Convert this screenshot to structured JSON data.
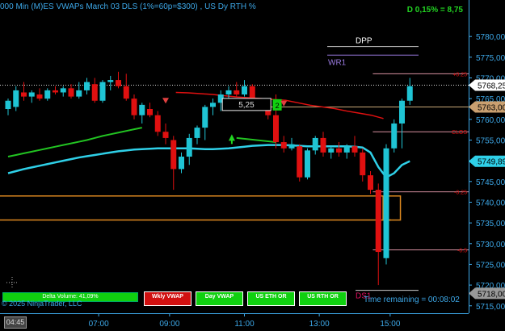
{
  "header": {
    "title": "000 Min (M)ES VWAPs March 03 DLS (1%=60p=$300) , US Dy RTH %",
    "daily_change": "D 0,15% = 8,75"
  },
  "colors": {
    "up": "#1fc4d4",
    "down": "#e01010",
    "vwap": "#2fd0e8",
    "green_line": "#22c422",
    "red_line": "#e01010",
    "orange_line": "#e08a20",
    "pink_line": "#d890a0",
    "axis": "#3da8e8"
  },
  "chart_data": {
    "type": "candlestick",
    "x_ticks": [
      "07:00",
      "09:00",
      "11:00",
      "13:00",
      "15:00"
    ],
    "y_ticks": [
      5715,
      5720,
      5725,
      5730,
      5735,
      5740,
      5745,
      5750,
      5755,
      5760,
      5765,
      5770,
      5775,
      5780
    ],
    "ylim": [
      5713.2,
      5785.3
    ],
    "price_labels": [
      {
        "value": 5768.25,
        "label": "5768,25",
        "style": "white"
      },
      {
        "value": 5763.0,
        "label": "5763,00",
        "style": "tan"
      },
      {
        "value": 5749.89,
        "label": "5749,89",
        "style": "cyan"
      },
      {
        "value": 5718.0,
        "label": "5718,00",
        "style": "grey"
      }
    ],
    "candles": [
      {
        "o": 5762.5,
        "h": 5765.0,
        "l": 5761.0,
        "c": 5764.5
      },
      {
        "o": 5763.0,
        "h": 5768.0,
        "l": 5762.0,
        "c": 5767.0
      },
      {
        "o": 5766.5,
        "h": 5769.0,
        "l": 5764.5,
        "c": 5765.5
      },
      {
        "o": 5765.5,
        "h": 5767.0,
        "l": 5764.0,
        "c": 5766.5
      },
      {
        "o": 5766.0,
        "h": 5767.5,
        "l": 5764.5,
        "c": 5765.0
      },
      {
        "o": 5765.0,
        "h": 5767.5,
        "l": 5764.5,
        "c": 5767.0
      },
      {
        "o": 5767.0,
        "h": 5768.0,
        "l": 5766.0,
        "c": 5766.5
      },
      {
        "o": 5766.5,
        "h": 5768.0,
        "l": 5765.5,
        "c": 5767.5
      },
      {
        "o": 5767.5,
        "h": 5768.5,
        "l": 5765.0,
        "c": 5765.5
      },
      {
        "o": 5765.5,
        "h": 5769.0,
        "l": 5765.0,
        "c": 5767.0
      },
      {
        "o": 5767.0,
        "h": 5770.0,
        "l": 5766.0,
        "c": 5769.0
      },
      {
        "o": 5768.5,
        "h": 5770.0,
        "l": 5764.0,
        "c": 5764.5
      },
      {
        "o": 5764.5,
        "h": 5769.5,
        "l": 5764.0,
        "c": 5769.0
      },
      {
        "o": 5769.0,
        "h": 5770.5,
        "l": 5767.0,
        "c": 5769.5
      },
      {
        "o": 5769.5,
        "h": 5771.5,
        "l": 5767.5,
        "c": 5768.0
      },
      {
        "o": 5768.0,
        "h": 5771.0,
        "l": 5764.5,
        "c": 5765.0
      },
      {
        "o": 5765.0,
        "h": 5766.0,
        "l": 5760.0,
        "c": 5761.0
      },
      {
        "o": 5761.0,
        "h": 5764.0,
        "l": 5759.0,
        "c": 5763.5
      },
      {
        "o": 5762.5,
        "h": 5764.0,
        "l": 5760.5,
        "c": 5761.0
      },
      {
        "o": 5761.0,
        "h": 5762.0,
        "l": 5756.0,
        "c": 5757.0
      },
      {
        "o": 5757.0,
        "h": 5759.0,
        "l": 5754.0,
        "c": 5755.5
      },
      {
        "o": 5755.0,
        "h": 5756.0,
        "l": 5743.0,
        "c": 5748.0
      },
      {
        "o": 5748.0,
        "h": 5752.0,
        "l": 5747.0,
        "c": 5751.0
      },
      {
        "o": 5751.0,
        "h": 5756.5,
        "l": 5749.0,
        "c": 5755.5
      },
      {
        "o": 5755.5,
        "h": 5758.5,
        "l": 5754.0,
        "c": 5758.0
      },
      {
        "o": 5758.0,
        "h": 5763.5,
        "l": 5755.0,
        "c": 5763.0
      },
      {
        "o": 5763.0,
        "h": 5765.0,
        "l": 5761.0,
        "c": 5764.0
      },
      {
        "o": 5764.0,
        "h": 5767.0,
        "l": 5762.0,
        "c": 5766.0
      },
      {
        "o": 5766.0,
        "h": 5768.0,
        "l": 5764.0,
        "c": 5767.0
      },
      {
        "o": 5767.0,
        "h": 5769.0,
        "l": 5765.5,
        "c": 5766.0
      },
      {
        "o": 5766.0,
        "h": 5769.5,
        "l": 5765.5,
        "c": 5768.0
      },
      {
        "o": 5768.0,
        "h": 5768.5,
        "l": 5763.0,
        "c": 5764.0
      },
      {
        "o": 5764.0,
        "h": 5765.0,
        "l": 5762.5,
        "c": 5763.0
      },
      {
        "o": 5763.0,
        "h": 5764.5,
        "l": 5760.0,
        "c": 5761.0
      },
      {
        "o": 5761.0,
        "h": 5766.0,
        "l": 5753.0,
        "c": 5754.5
      },
      {
        "o": 5754.5,
        "h": 5756.0,
        "l": 5752.0,
        "c": 5753.0
      },
      {
        "o": 5753.0,
        "h": 5755.5,
        "l": 5752.5,
        "c": 5754.0
      },
      {
        "o": 5753.5,
        "h": 5754.0,
        "l": 5745.0,
        "c": 5746.0
      },
      {
        "o": 5746.0,
        "h": 5753.0,
        "l": 5745.5,
        "c": 5752.5
      },
      {
        "o": 5752.5,
        "h": 5756.0,
        "l": 5751.5,
        "c": 5755.5
      },
      {
        "o": 5755.5,
        "h": 5757.0,
        "l": 5751.0,
        "c": 5752.0
      },
      {
        "o": 5752.0,
        "h": 5753.5,
        "l": 5750.5,
        "c": 5753.0
      },
      {
        "o": 5753.0,
        "h": 5754.5,
        "l": 5751.0,
        "c": 5752.0
      },
      {
        "o": 5752.0,
        "h": 5754.0,
        "l": 5750.5,
        "c": 5753.5
      },
      {
        "o": 5753.5,
        "h": 5756.0,
        "l": 5751.0,
        "c": 5752.0
      },
      {
        "o": 5752.0,
        "h": 5753.0,
        "l": 5745.0,
        "c": 5746.5
      },
      {
        "o": 5746.5,
        "h": 5747.5,
        "l": 5742.0,
        "c": 5743.0
      },
      {
        "o": 5743.0,
        "h": 5744.5,
        "l": 5720.0,
        "c": 5728.0
      },
      {
        "o": 5726.5,
        "h": 5754.0,
        "l": 5725.0,
        "c": 5753.0
      },
      {
        "o": 5753.0,
        "h": 5760.0,
        "l": 5752.0,
        "c": 5759.0
      },
      {
        "o": 5759.0,
        "h": 5765.0,
        "l": 5753.0,
        "c": 5764.5
      },
      {
        "o": 5764.5,
        "h": 5770.0,
        "l": 5763.5,
        "c": 5768.0
      }
    ],
    "vwap": [
      5747.0,
      5747.5,
      5748.0,
      5748.4,
      5748.8,
      5749.2,
      5749.6,
      5750.0,
      5750.4,
      5750.8,
      5751.1,
      5751.4,
      5751.7,
      5752.0,
      5752.3,
      5752.5,
      5752.7,
      5752.8,
      5752.9,
      5753.0,
      5753.0,
      5753.0,
      5753.0,
      5753.0,
      5752.9,
      5752.8,
      5752.8,
      5752.9,
      5753.0,
      5753.2,
      5753.4,
      5753.6,
      5753.7,
      5753.8,
      5753.8,
      5753.8,
      5753.7,
      5753.6,
      5753.5,
      5753.5,
      5753.5,
      5753.5,
      5753.5,
      5753.5,
      5753.4,
      5753.2,
      5752.0,
      5748.5,
      5746.0,
      5747.0,
      5749.0,
      5749.9
    ],
    "green_vwap": [
      5751.0,
      5751.4,
      5751.8,
      5752.2,
      5752.6,
      5753.0,
      5753.4,
      5753.8,
      5754.2,
      5754.6,
      5755.0,
      5755.5,
      5756.0,
      5756.4,
      5756.8,
      5757.2,
      5757.6,
      5758.0
    ],
    "red_vwap": [
      5766.5,
      5766.4,
      5766.2,
      5766.0,
      5765.7,
      5765.4,
      5765.2,
      5765.0,
      5764.8,
      5764.6,
      5764.0,
      5763.4,
      5763.0,
      5762.6,
      5762.0,
      5761.5,
      5761.0,
      5760.2
    ],
    "levels": [
      {
        "name": "DPP",
        "value": 5777.0
      },
      {
        "name": "WR1",
        "value": 5775.5
      },
      {
        "name": "+0.25",
        "value": 5771.0
      },
      {
        "name": "CLOS",
        "value": 5757.0
      },
      {
        "name": "-0.25",
        "value": 5742.5
      },
      {
        "name": "-0.5",
        "value": 5728.5
      },
      {
        "name": "DS1",
        "value": 5719.5
      }
    ],
    "orange_levels": [
      5741.5,
      5735.7
    ],
    "annotation": {
      "text": "5,25",
      "tag": "2"
    }
  },
  "buttons": [
    {
      "label": "Wkly VWAP",
      "color": "red"
    },
    {
      "label": "Day VWAP",
      "color": "green"
    },
    {
      "label": "US ETH OR",
      "color": "green"
    },
    {
      "label": "US RTH OR",
      "color": "green"
    }
  ],
  "footer": {
    "delta_volume": "Delta Volume: 41,09%",
    "copyright": "© 2025 NinjaTrader, LLC",
    "time_remaining": "Time remaining = 00:08:02",
    "current_time": "04:45"
  }
}
